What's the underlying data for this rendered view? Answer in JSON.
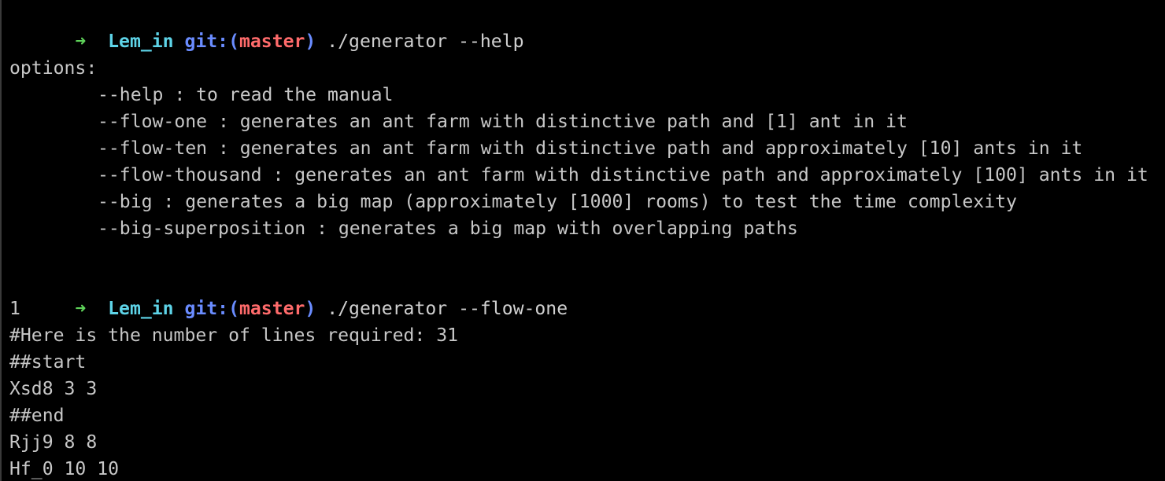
{
  "colors": {
    "background": "#000000",
    "text": "#c7c7c7",
    "prompt_arrow": "#5fd35a",
    "prompt_dir": "#5ed4e8",
    "prompt_git": "#6a8cff",
    "prompt_branch": "#ff6b6b"
  },
  "prompt": {
    "arrow_icon": "➜",
    "dir": "Lem_in",
    "git_open": "git:(",
    "branch": "master",
    "git_close": ")"
  },
  "commands": [
    "./generator --help",
    "./generator --flow-one"
  ],
  "help_output": {
    "header": "options:",
    "options": [
      "--help : to read the manual",
      "--flow-one : generates an ant farm with distinctive path and [1] ant in it",
      "--flow-ten : generates an ant farm with distinctive path and approximately [10] ants in it",
      "--flow-thousand : generates an ant farm with distinctive path and approximately [100] ants in it",
      "--big : generates a big map (approximately [1000] rooms) to test the time complexity",
      "--big-superposition : generates a big map with overlapping paths"
    ]
  },
  "flow_one_output": [
    "1",
    "#Here is the number of lines required: 31",
    "##start",
    "Xsd8 3 3",
    "##end",
    "Rjj9 8 8",
    "Hf_0 10 10"
  ]
}
